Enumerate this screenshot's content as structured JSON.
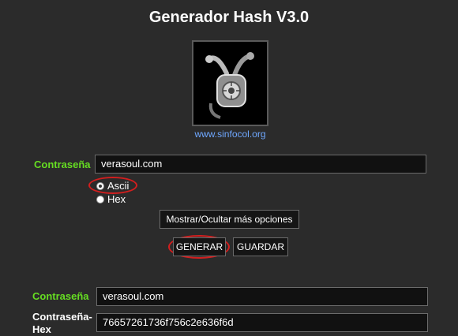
{
  "header": {
    "title": "Generador Hash V3.0"
  },
  "logo": {
    "icon": "padlock-skull-icon",
    "link_text": "www.sinfocol.org"
  },
  "input_section": {
    "password_label": "Contraseña",
    "password_value": "verasoul.com",
    "encoding_options": [
      {
        "label": "Ascii",
        "selected": true
      },
      {
        "label": "Hex",
        "selected": false
      }
    ],
    "more_options_label": "Mostrar/Ocultar más opciones",
    "generate_label": "GENERAR",
    "save_label": "GUARDAR"
  },
  "results": {
    "password_label": "Contraseña",
    "password_value": "verasoul.com",
    "password_hex_label_line1": "Contraseña-",
    "password_hex_label_line2": "Hex",
    "password_hex_value": "76657261736f756c2e636f6d"
  },
  "colors": {
    "background": "#2b2b2b",
    "label_green": "#66dd22",
    "link_blue": "#6fa8ff",
    "highlight_red": "#d21e1e"
  }
}
